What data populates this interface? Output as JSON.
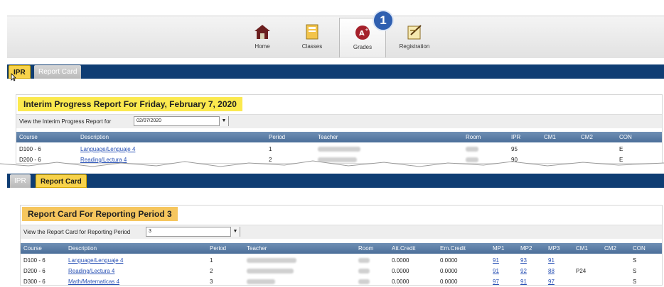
{
  "nav": {
    "items": [
      {
        "label": "Home",
        "icon": "home-icon"
      },
      {
        "label": "Classes",
        "icon": "classes-icon"
      },
      {
        "label": "Grades",
        "icon": "grades-icon",
        "active": true
      },
      {
        "label": "Registration",
        "icon": "registration-icon"
      }
    ],
    "badge": "1"
  },
  "tabs_top": {
    "ipr": "IPR",
    "report_card": "Report Card"
  },
  "ipr_panel": {
    "title": "Interim Progress Report For Friday, February 7, 2020",
    "filter_label": "View the Interim Progress Report for",
    "filter_value": "02/07/2020",
    "columns": [
      "Course",
      "Description",
      "Period",
      "Teacher",
      "Room",
      "IPR",
      "CM1",
      "CM2",
      "CON"
    ],
    "rows": [
      {
        "course": "D100 - 6",
        "description": "Language/Lenguaje 4",
        "period": "1",
        "ipr": "95",
        "cm1": "",
        "cm2": "",
        "con": "E"
      },
      {
        "course": "D200 - 6",
        "description": "Reading/Lectura 4",
        "period": "2",
        "ipr": "90",
        "cm1": "",
        "cm2": "",
        "con": "E"
      }
    ]
  },
  "tabs_bottom": {
    "ipr": "IPR",
    "report_card": "Report Card"
  },
  "rc_panel": {
    "title": "Report Card For Reporting Period 3",
    "filter_label": "View the Report Card for Reporting Period",
    "filter_value": "3",
    "columns": [
      "Course",
      "Description",
      "Period",
      "Teacher",
      "Room",
      "Att.Credit",
      "Ern.Credit",
      "MP1",
      "MP2",
      "MP3",
      "CM1",
      "CM2",
      "CON"
    ],
    "rows": [
      {
        "course": "D100 - 6",
        "description": "Language/Lenguaje 4",
        "period": "1",
        "att": "0.0000",
        "ern": "0.0000",
        "mp1": "91",
        "mp2": "93",
        "mp3": "91",
        "cm1": "",
        "cm2": "",
        "con": "S"
      },
      {
        "course": "D200 - 6",
        "description": "Reading/Lectura 4",
        "period": "2",
        "att": "0.0000",
        "ern": "0.0000",
        "mp1": "91",
        "mp2": "92",
        "mp3": "88",
        "cm1": "P24",
        "cm2": "",
        "con": "S"
      },
      {
        "course": "D300 - 6",
        "description": "Math/Matematicas 4",
        "period": "3",
        "att": "0.0000",
        "ern": "0.0000",
        "mp1": "97",
        "mp2": "91",
        "mp3": "97",
        "cm1": "",
        "cm2": "",
        "con": "S"
      }
    ]
  },
  "colors": {
    "navy": "#0f3d73",
    "yellow": "#fbe94e",
    "orange": "#f6c65e",
    "badge": "#2f5fb0"
  }
}
